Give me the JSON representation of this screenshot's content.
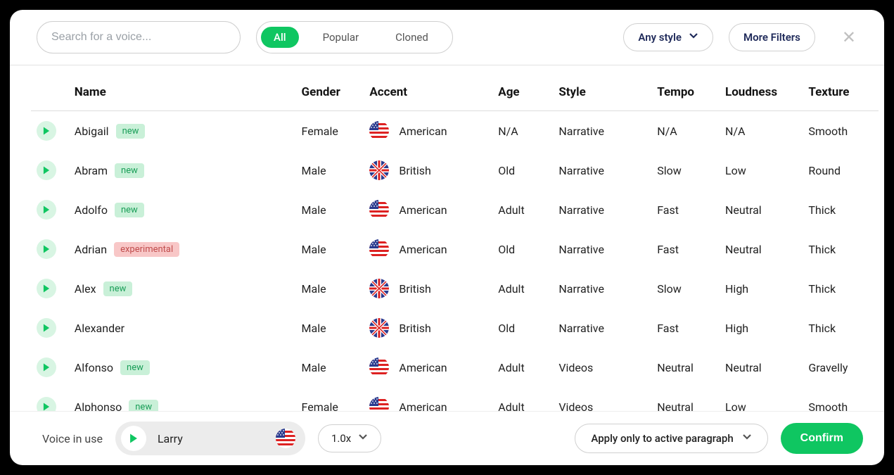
{
  "search": {
    "placeholder": "Search for a voice..."
  },
  "tabs": {
    "all": "All",
    "popular": "Popular",
    "cloned": "Cloned"
  },
  "filters": {
    "any_style": "Any style",
    "more": "More Filters"
  },
  "columns": {
    "name": "Name",
    "gender": "Gender",
    "accent": "Accent",
    "age": "Age",
    "style": "Style",
    "tempo": "Tempo",
    "loudness": "Loudness",
    "texture": "Texture"
  },
  "badges": {
    "new": "new",
    "experimental": "experimental"
  },
  "rows": [
    {
      "name": "Abigail",
      "badge": "new",
      "gender": "Female",
      "accent": "American",
      "flag": "us",
      "age": "N/A",
      "style": "Narrative",
      "tempo": "N/A",
      "loudness": "N/A",
      "texture": "Smooth"
    },
    {
      "name": "Abram",
      "badge": "new",
      "gender": "Male",
      "accent": "British",
      "flag": "uk",
      "age": "Old",
      "style": "Narrative",
      "tempo": "Slow",
      "loudness": "Low",
      "texture": "Round"
    },
    {
      "name": "Adolfo",
      "badge": "new",
      "gender": "Male",
      "accent": "American",
      "flag": "us",
      "age": "Adult",
      "style": "Narrative",
      "tempo": "Fast",
      "loudness": "Neutral",
      "texture": "Thick"
    },
    {
      "name": "Adrian",
      "badge": "experimental",
      "gender": "Male",
      "accent": "American",
      "flag": "us",
      "age": "Old",
      "style": "Narrative",
      "tempo": "Fast",
      "loudness": "Neutral",
      "texture": "Thick"
    },
    {
      "name": "Alex",
      "badge": "new",
      "gender": "Male",
      "accent": "British",
      "flag": "uk",
      "age": "Adult",
      "style": "Narrative",
      "tempo": "Slow",
      "loudness": "High",
      "texture": "Thick"
    },
    {
      "name": "Alexander",
      "badge": "",
      "gender": "Male",
      "accent": "British",
      "flag": "uk",
      "age": "Old",
      "style": "Narrative",
      "tempo": "Fast",
      "loudness": "High",
      "texture": "Thick"
    },
    {
      "name": "Alfonso",
      "badge": "new",
      "gender": "Male",
      "accent": "American",
      "flag": "us",
      "age": "Adult",
      "style": "Videos",
      "tempo": "Neutral",
      "loudness": "Neutral",
      "texture": "Gravelly"
    },
    {
      "name": "Alphonso",
      "badge": "new",
      "gender": "Female",
      "accent": "American",
      "flag": "us",
      "age": "Adult",
      "style": "Videos",
      "tempo": "Neutral",
      "loudness": "Low",
      "texture": "Smooth"
    }
  ],
  "footer": {
    "label": "Voice in use",
    "voice_name": "Larry",
    "voice_flag": "us",
    "speed": "1.0x",
    "apply": "Apply only to active paragraph",
    "confirm": "Confirm"
  }
}
